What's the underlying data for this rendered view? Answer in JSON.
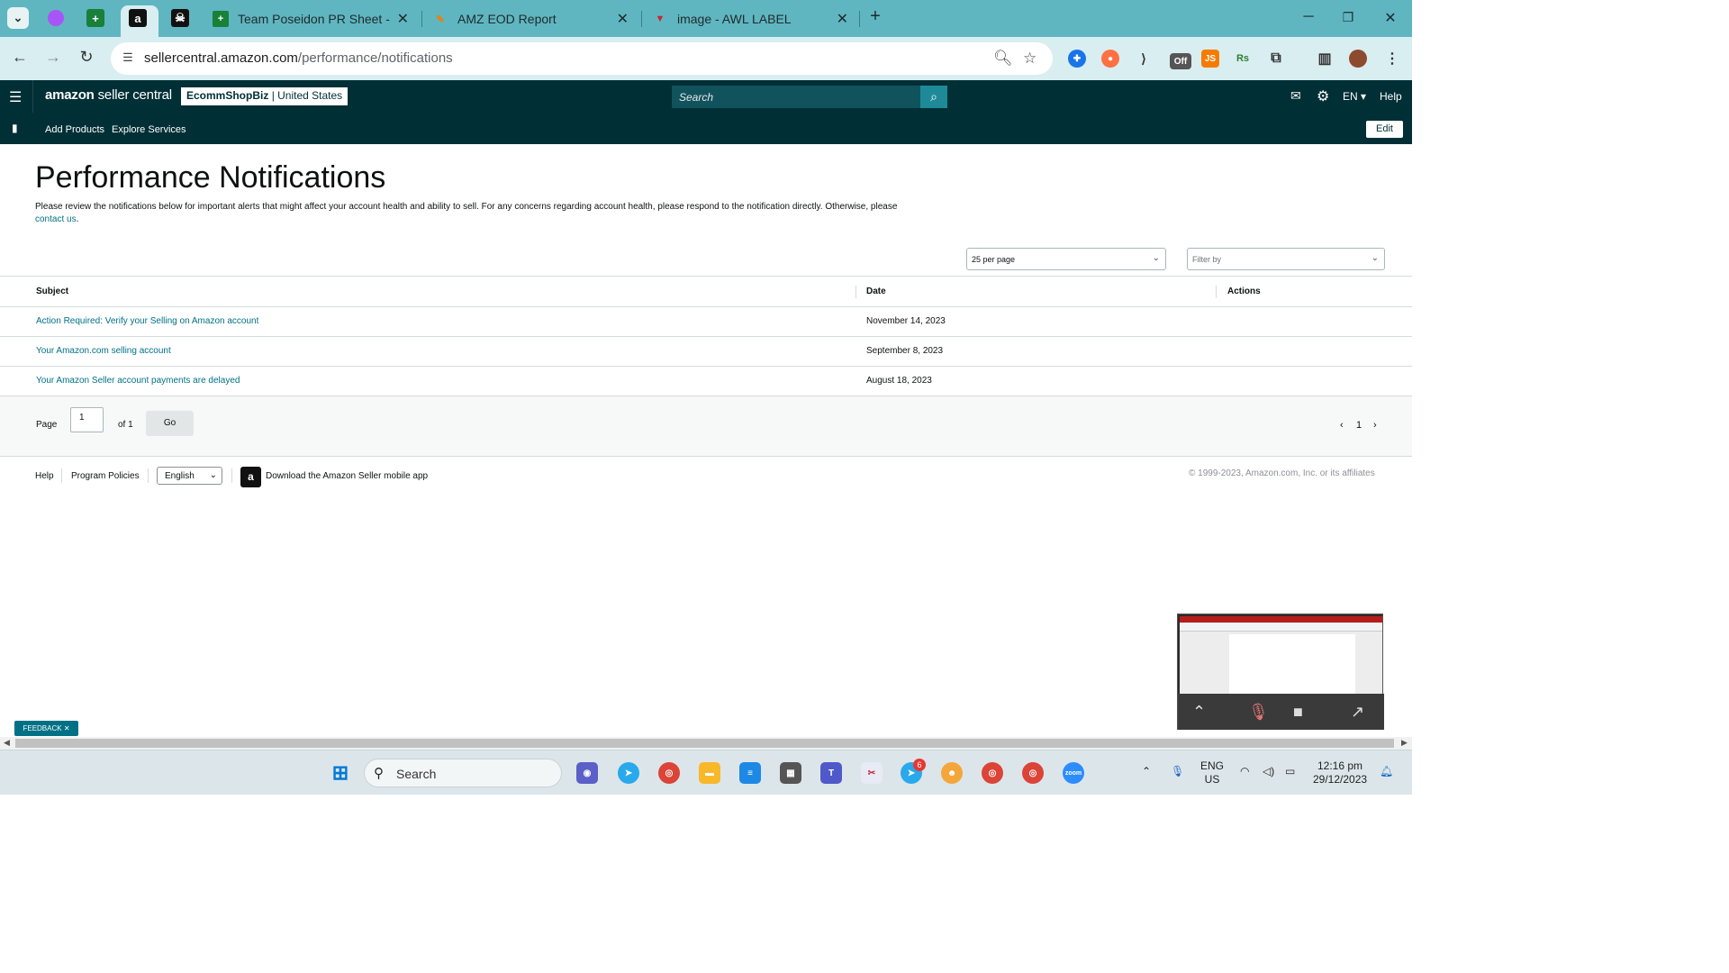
{
  "browser": {
    "tabs": [
      {
        "title": "Team Poseidon PR Sheet - Goo",
        "icon": "google-sheets-icon"
      },
      {
        "title": "AMZ EOD Report",
        "icon": "report-icon"
      },
      {
        "title": "image - AWL LABEL",
        "icon": "label-icon"
      }
    ],
    "url_host": "sellercentral.amazon.com",
    "url_path": "/performance/notifications",
    "extensions": [
      "off-badge",
      "js-badge",
      "rs-badge"
    ]
  },
  "header": {
    "logo_brand": "amazon",
    "logo_rest": "seller central",
    "store_name": "EcommShopBiz",
    "store_region": "| United States",
    "search_placeholder": "Search",
    "lang": "EN",
    "help": "Help"
  },
  "nav": {
    "add_products": "Add Products",
    "explore_services": "Explore Services",
    "edit": "Edit"
  },
  "main": {
    "title": "Performance Notifications",
    "description": "Please review the notifications below for important alerts that might affect your account health and ability to sell. For any concerns regarding account health, please respond to the notification directly. Otherwise, please",
    "contact_link": "contact us",
    "per_page": "25 per page",
    "filter_placeholder": "Filter by"
  },
  "table": {
    "headers": {
      "subject": "Subject",
      "date": "Date",
      "actions": "Actions"
    },
    "rows": [
      {
        "subject": "Action Required: Verify your Selling on Amazon account",
        "date": "November 14, 2023"
      },
      {
        "subject": "Your Amazon.com selling account",
        "date": "September 8, 2023"
      },
      {
        "subject": "Your Amazon Seller account payments are delayed",
        "date": "August 18, 2023"
      }
    ]
  },
  "pager": {
    "page_label": "Page",
    "page_value": "1",
    "of_label": "of 1",
    "go": "Go",
    "current": "1"
  },
  "footer": {
    "help": "Help",
    "program_policies": "Program Policies",
    "language": "English",
    "app_text": "Download the Amazon Seller mobile app",
    "copyright": "© 1999-2023, Amazon.com, Inc. or its affiliates"
  },
  "feedback": "FEEDBACK ✕",
  "taskbar": {
    "search": "Search",
    "lang_line1": "ENG",
    "lang_line2": "US",
    "time": "12:16 pm",
    "date": "29/12/2023",
    "telegram_badge": "6"
  }
}
